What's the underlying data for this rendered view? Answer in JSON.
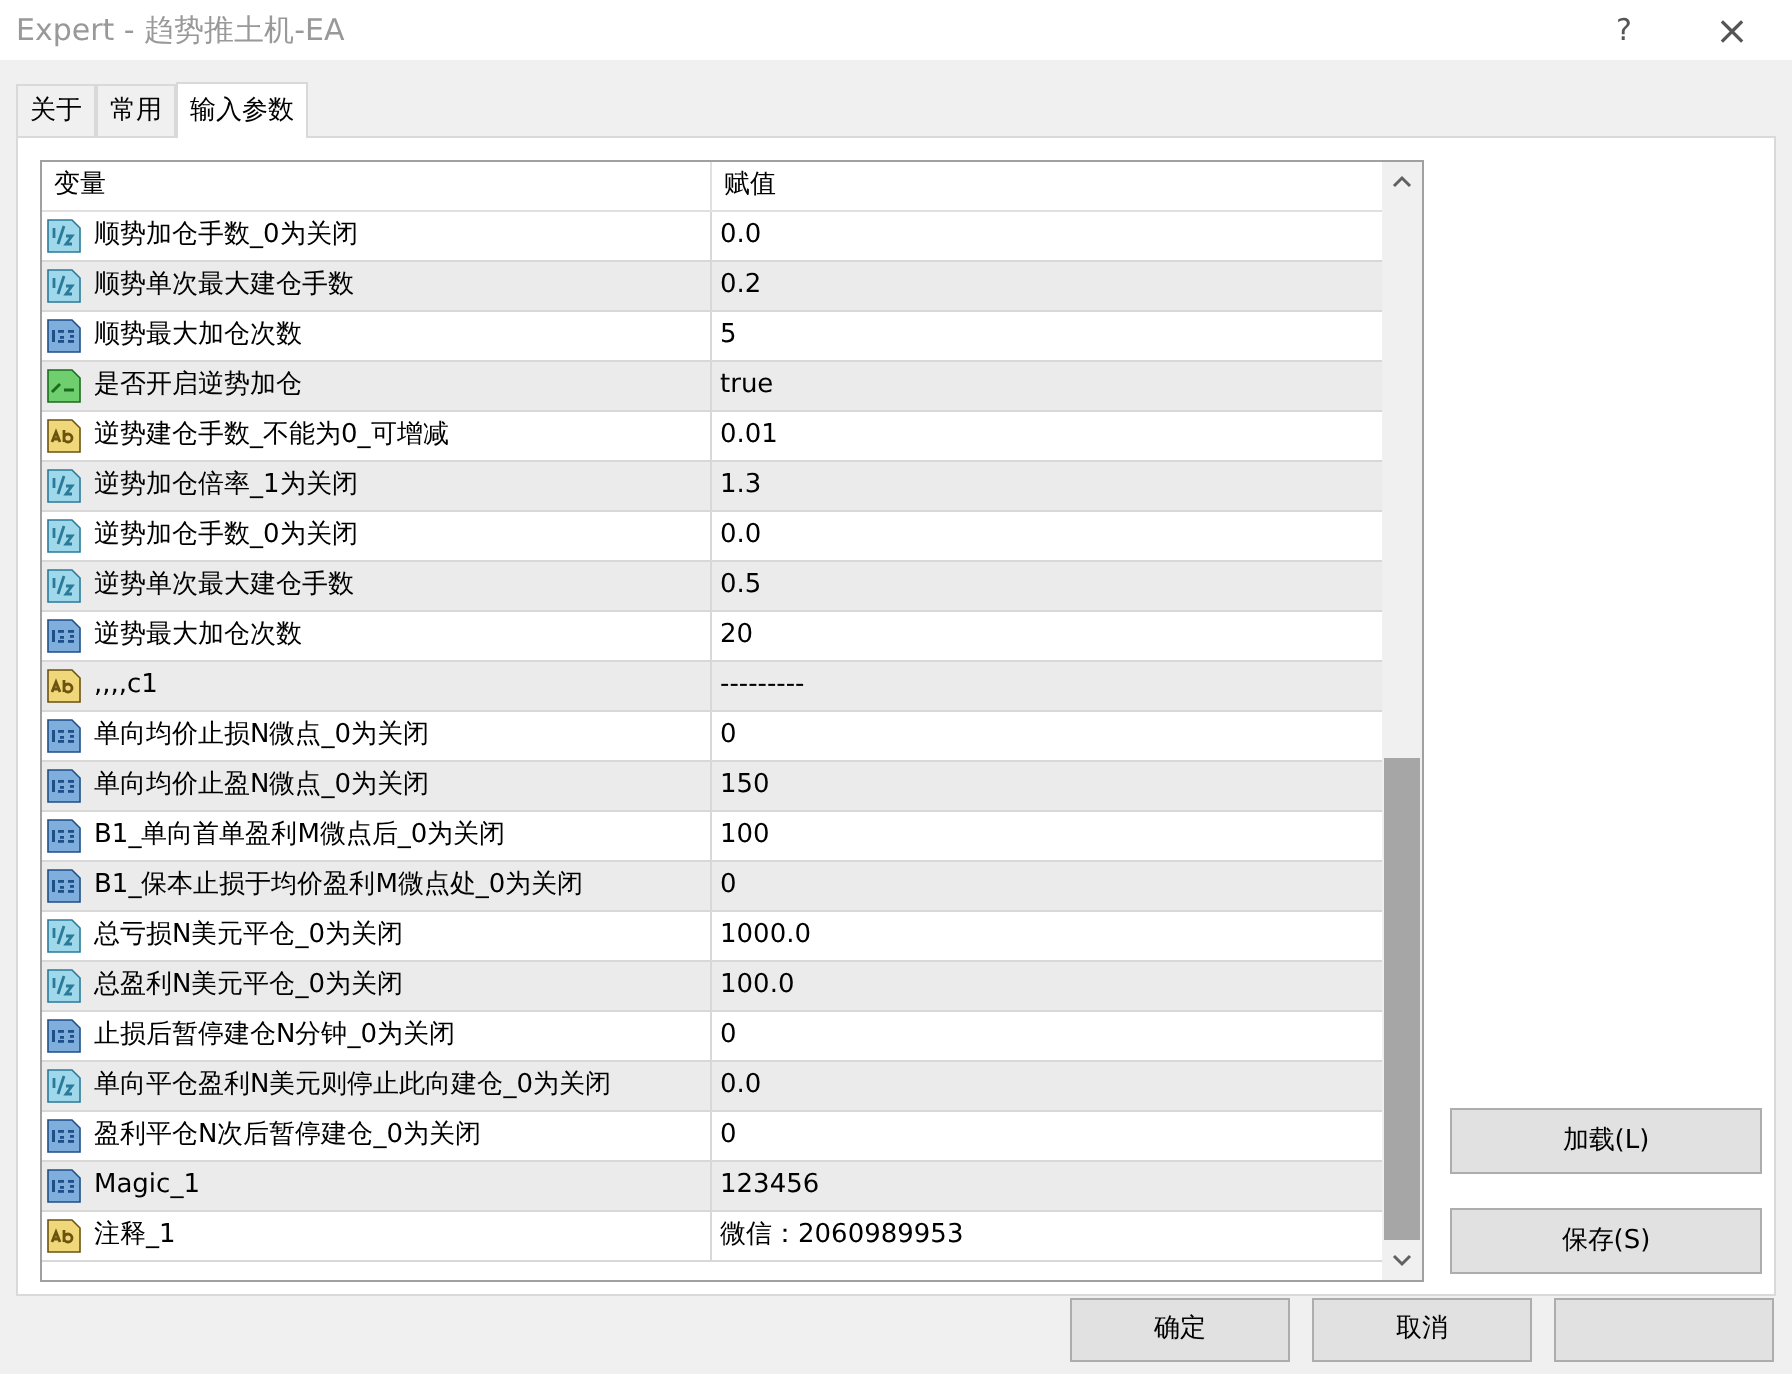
{
  "window": {
    "title": "Expert - 趋势推土机-EA",
    "help": "?",
    "close": "×"
  },
  "tabs": [
    {
      "label": "关于",
      "selected": false
    },
    {
      "label": "常用",
      "selected": false
    },
    {
      "label": "输入参数",
      "selected": true
    }
  ],
  "table": {
    "columns": [
      "变量",
      "赋值"
    ],
    "rows": [
      {
        "kind": "double",
        "name": "顺势加仓手数_0为关闭",
        "value": "0.0"
      },
      {
        "kind": "double",
        "name": "顺势单次最大建仓手数",
        "value": "0.2"
      },
      {
        "kind": "int",
        "name": "顺势最大加仓次数",
        "value": "5"
      },
      {
        "kind": "bool",
        "name": "是否开启逆势加仓",
        "value": "true"
      },
      {
        "kind": "string",
        "name": "逆势建仓手数_不能为0_可增减",
        "value": "0.01"
      },
      {
        "kind": "double",
        "name": "逆势加仓倍率_1为关闭",
        "value": "1.3"
      },
      {
        "kind": "double",
        "name": "逆势加仓手数_0为关闭",
        "value": "0.0"
      },
      {
        "kind": "double",
        "name": "逆势单次最大建仓手数",
        "value": "0.5"
      },
      {
        "kind": "int",
        "name": "逆势最大加仓次数",
        "value": "20"
      },
      {
        "kind": "string",
        "name": ",,,,c1",
        "value": "---------"
      },
      {
        "kind": "int",
        "name": "单向均价止损N微点_0为关闭",
        "value": "0"
      },
      {
        "kind": "int",
        "name": "单向均价止盈N微点_0为关闭",
        "value": "150"
      },
      {
        "kind": "int",
        "name": "B1_单向首单盈利M微点后_0为关闭",
        "value": "100"
      },
      {
        "kind": "int",
        "name": "B1_保本止损于均价盈利M微点处_0为关闭",
        "value": "0"
      },
      {
        "kind": "double",
        "name": "总亏损N美元平仓_0为关闭",
        "value": "1000.0"
      },
      {
        "kind": "double",
        "name": "总盈利N美元平仓_0为关闭",
        "value": "100.0"
      },
      {
        "kind": "int",
        "name": "止损后暂停建仓N分钟_0为关闭",
        "value": "0"
      },
      {
        "kind": "double",
        "name": "单向平仓盈利N美元则停止此向建仓_0为关闭",
        "value": "0.0"
      },
      {
        "kind": "int",
        "name": "盈利平仓N次后暂停建仓_0为关闭",
        "value": "0"
      },
      {
        "kind": "int",
        "name": "Magic_1",
        "value": "123456"
      },
      {
        "kind": "string",
        "name": "注释_1",
        "value": "微信：2060989953"
      }
    ]
  },
  "side_buttons": [
    "加载(L)",
    "保存(S)"
  ],
  "dialog_buttons": [
    "确定",
    "取消"
  ]
}
